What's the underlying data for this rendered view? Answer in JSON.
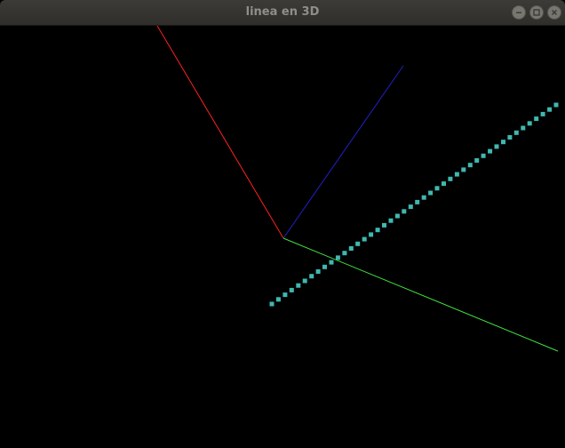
{
  "window": {
    "title": "linea en 3D",
    "controls": [
      {
        "name": "minimize-button",
        "icon": "minimize-icon"
      },
      {
        "name": "maximize-button",
        "icon": "maximize-icon"
      },
      {
        "name": "close-button",
        "icon": "close-icon"
      }
    ]
  },
  "scene": {
    "background": "#000000",
    "axes": [
      {
        "name": "x-axis-line",
        "color": "#ff2020"
      },
      {
        "name": "y-axis-line",
        "color": "#2020c8"
      },
      {
        "name": "z-axis-line",
        "color": "#40e040"
      }
    ],
    "dotted_line": {
      "color": "#3fb8b0",
      "point_count": 44
    }
  }
}
